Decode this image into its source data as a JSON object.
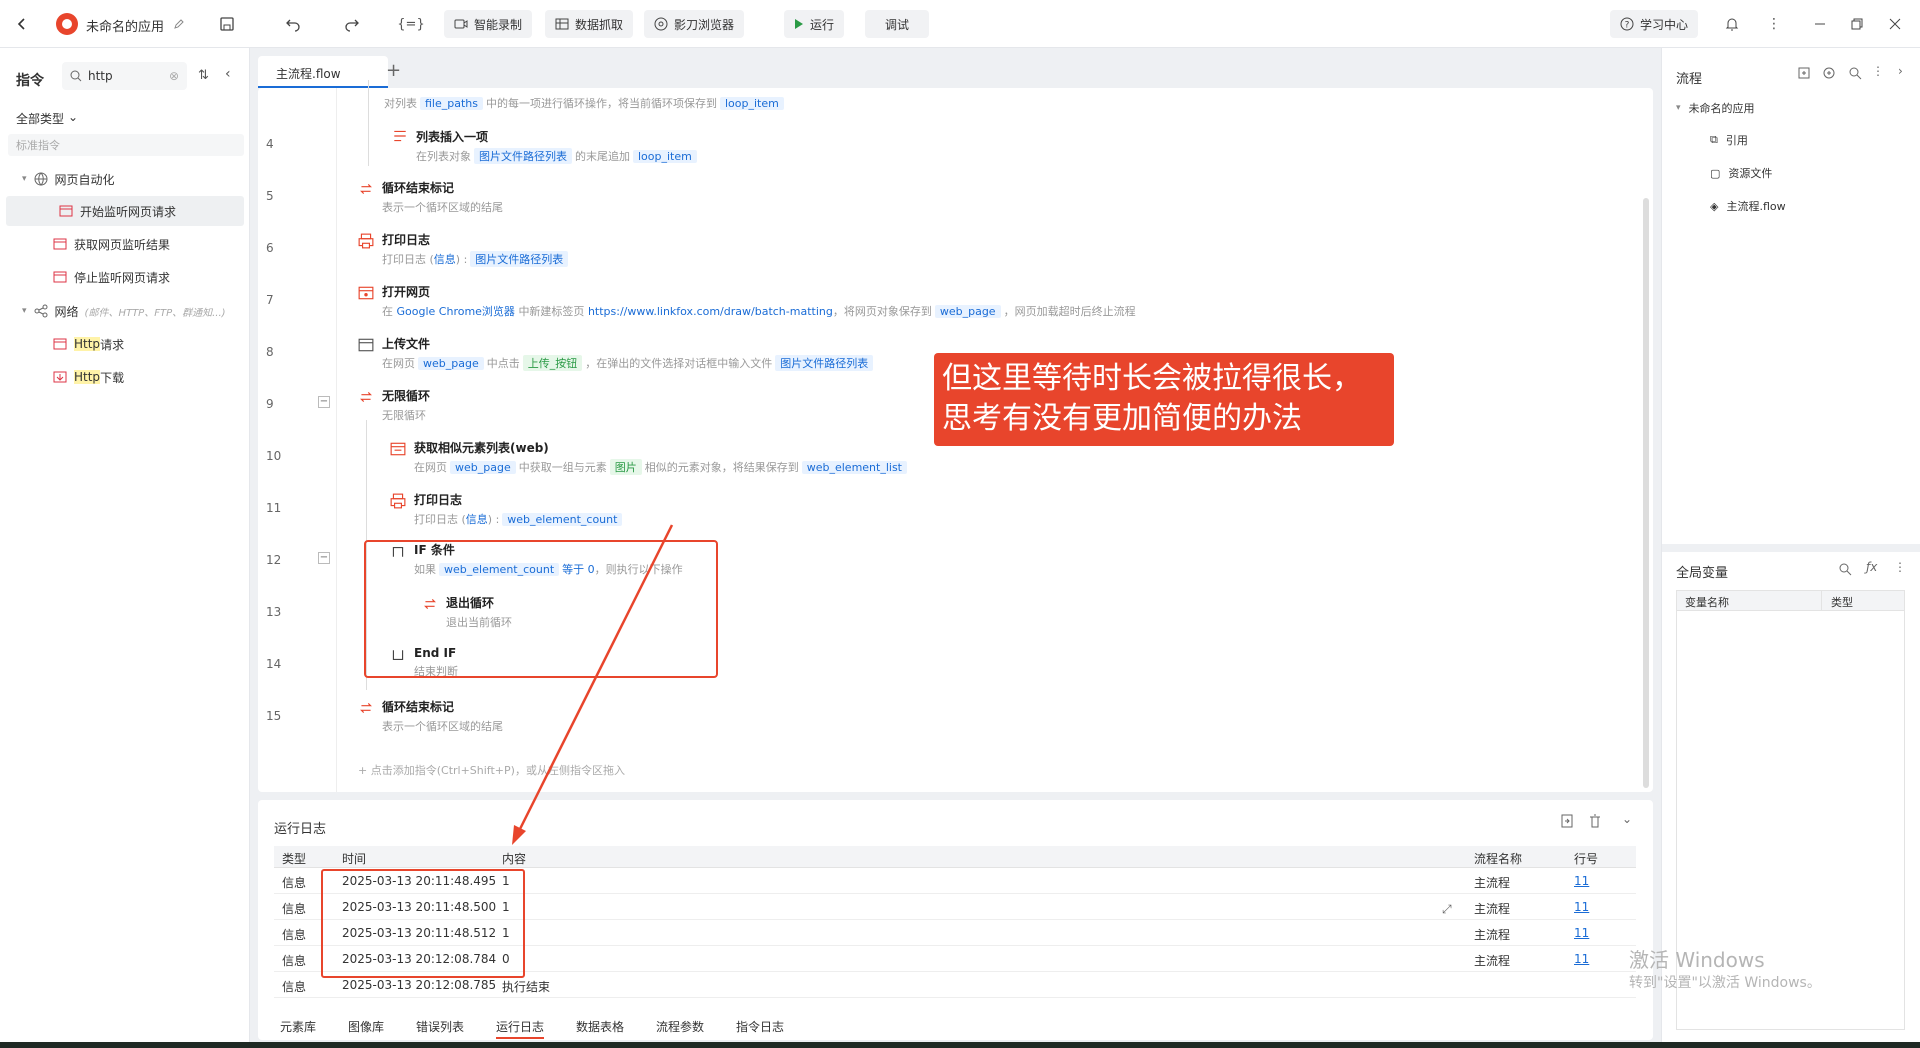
{
  "app": {
    "name": "未命名的应用"
  },
  "toolbar": {
    "smart_record": "智能录制",
    "data_capture": "数据抓取",
    "browser": "影刀浏览器",
    "run": "运行",
    "debug": "调试",
    "help": "学习中心"
  },
  "left": {
    "title": "指令",
    "search_value": "http",
    "filter": "全部类型",
    "search_placeholder": "标准指令",
    "groups": [
      {
        "label": "网页自动化",
        "children": [
          "开始监听网页请求",
          "获取网页监听结果",
          "停止监听网页请求"
        ]
      },
      {
        "label": "网络",
        "note": "(邮件、HTTP、FTP、群通知...)",
        "children": [
          "Http 请求",
          "Http 下载"
        ]
      }
    ],
    "http_hl": "Http",
    "http_children_rest": [
      " 请求",
      " 下载"
    ]
  },
  "editor": {
    "tab": "主流程.flow",
    "steps": [
      {
        "no": "",
        "desc_pre": "对列表",
        "t1": "file_paths",
        "desc_mid": "中的每一项进行循环操作，将当前循环项保存到",
        "t2": "loop_item"
      },
      {
        "no": "4",
        "title": "列表插入一项",
        "desc_pre": "在列表对象",
        "t1": "图片文件路径列表",
        "desc_mid": "的末尾追加",
        "t2": "loop_item"
      },
      {
        "no": "5",
        "title": "循环结束标记",
        "desc": "表示一个循环区域的结尾"
      },
      {
        "no": "6",
        "title": "打印日志",
        "desc_pre": "打印日志 (",
        "kw": "信息",
        "desc_mid": ") :",
        "t1": "图片文件路径列表"
      },
      {
        "no": "7",
        "title": "打开网页",
        "desc_pre": "在",
        "kw": "Google Chrome浏览器",
        "desc_mid": "中新建标签页",
        "url": "https://www.linkfox.com/draw/batch-matting",
        "desc_mid2": "，将网页对象保存到",
        "t1": "web_page",
        "desc_post": "，网页加载超时后终止流程"
      },
      {
        "no": "8",
        "title": "上传文件",
        "desc_pre": "在网页",
        "t1": "web_page",
        "desc_mid": "中点击",
        "t2": "上传_按钮",
        "desc_mid2": "，在弹出的文件选择对话框中输入文件",
        "t3": "图片文件路径列表"
      },
      {
        "no": "9",
        "title": "无限循环",
        "desc": "无限循环"
      },
      {
        "no": "10",
        "title": "获取相似元素列表(web)",
        "desc_pre": "在网页",
        "t1": "web_page",
        "desc_mid": "中获取一组与元素",
        "t2": "图片",
        "desc_mid2": "相似的元素对象，将结果保存到",
        "t3": "web_element_list"
      },
      {
        "no": "11",
        "title": "打印日志",
        "desc_pre": "打印日志 (",
        "kw": "信息",
        "desc_mid": ") :",
        "t1": "web_element_count"
      },
      {
        "no": "12",
        "title": "IF 条件",
        "desc_pre": "如果",
        "t1": "web_element_count",
        "kw": "等于 0",
        "desc_mid": "，则执行以下操作"
      },
      {
        "no": "13",
        "title": "退出循环",
        "desc": "退出当前循环"
      },
      {
        "no": "14",
        "title": "End IF",
        "desc": "结束判断"
      },
      {
        "no": "15",
        "title": "循环结束标记",
        "desc": "表示一个循环区域的结尾"
      }
    ],
    "add_hint": "点击添加指令(Ctrl+Shift+P)，或从左侧指令区拖入",
    "annotation": "但这里等待时长会被拉得很长，思考有没有更加简便的办法"
  },
  "log": {
    "title": "运行日志",
    "columns": [
      "类型",
      "时间",
      "内容",
      "流程名称",
      "行号"
    ],
    "rows": [
      {
        "type": "信息",
        "time": "2025-03-13 20:11:48.495",
        "content": "1",
        "flow": "主流程",
        "line": "11"
      },
      {
        "type": "信息",
        "time": "2025-03-13 20:11:48.500",
        "content": "1",
        "flow": "主流程",
        "line": "11"
      },
      {
        "type": "信息",
        "time": "2025-03-13 20:11:48.512",
        "content": "1",
        "flow": "主流程",
        "line": "11"
      },
      {
        "type": "信息",
        "time": "2025-03-13 20:12:08.784",
        "content": "0",
        "flow": "主流程",
        "line": "11"
      },
      {
        "type": "信息",
        "time": "2025-03-13 20:12:08.785",
        "content": "执行结束",
        "flow": "",
        "line": ""
      }
    ],
    "tabs": [
      "元素库",
      "图像库",
      "错误列表",
      "运行日志",
      "数据表格",
      "流程参数",
      "指令日志"
    ],
    "active_tab": "运行日志"
  },
  "right": {
    "flow_title": "流程",
    "tree_root": "未命名的应用",
    "tree_items": [
      "引用",
      "资源文件",
      "主流程.flow"
    ],
    "globals_title": "全局变量",
    "var_cols": [
      "变量名称",
      "类型"
    ]
  },
  "watermark": {
    "line1": "激活 Windows",
    "line2": "转到\"设置\"以激活 Windows。"
  },
  "colors": {
    "accent": "#1a6cd6",
    "annotation": "#e8452c",
    "highlight": "#fff3a8"
  }
}
